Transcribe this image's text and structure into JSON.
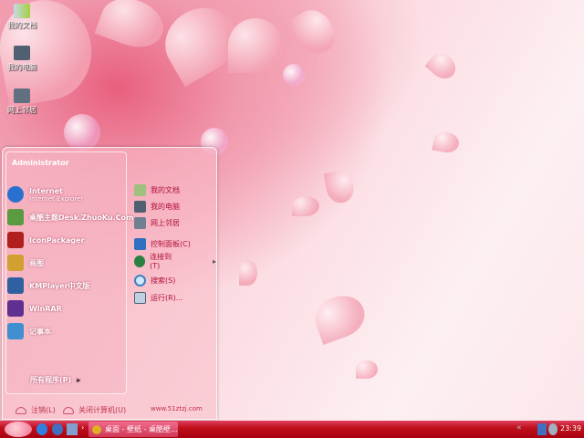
{
  "desktop_icons": [
    {
      "label": "我的文档",
      "icon": "my-documents-icon"
    },
    {
      "label": "我的电脑",
      "icon": "my-computer-icon"
    },
    {
      "label": "网上邻居",
      "icon": "network-icon"
    }
  ],
  "start_menu": {
    "user": "Administrator",
    "programs": [
      {
        "label": "Internet",
        "sub": "Internet Explorer",
        "icon": "ie-icon",
        "color": "#2a70d0"
      },
      {
        "label": "桌酷主题Desk.ZhuoKu.Com",
        "icon": "zhuoku-icon",
        "color": "#5a9a40"
      },
      {
        "label": "IconPackager",
        "icon": "iconpackager-icon",
        "color": "#b02020"
      },
      {
        "label": "画图",
        "icon": "paint-icon",
        "color": "#d0a030"
      },
      {
        "label": "KMPlayer中文版",
        "icon": "kmplayer-icon",
        "color": "#3060a0"
      },
      {
        "label": "WinRAR",
        "icon": "winrar-icon",
        "color": "#603090"
      },
      {
        "label": "记事本",
        "icon": "notepad-icon",
        "color": "#4090d0"
      }
    ],
    "all_programs": "所有程序(P)",
    "places": [
      {
        "label": "我的文档",
        "icon": "my-documents-icon"
      },
      {
        "label": "我的电脑",
        "icon": "my-computer-icon"
      },
      {
        "label": "网上邻居",
        "icon": "network-icon"
      },
      {
        "label": "控制面板(C)",
        "icon": "control-panel-icon"
      },
      {
        "label": "连接到(T)",
        "icon": "connect-icon"
      },
      {
        "label": "搜索(S)",
        "icon": "search-icon"
      },
      {
        "label": "运行(R)...",
        "icon": "run-icon"
      }
    ],
    "logoff": "注销(L)",
    "shutdown": "关闭计算机(U)",
    "website": "www.51ztzj.com"
  },
  "taskbar": {
    "task": "桌面 - 壁纸 - 桌酷壁...",
    "clock": "23:39"
  }
}
